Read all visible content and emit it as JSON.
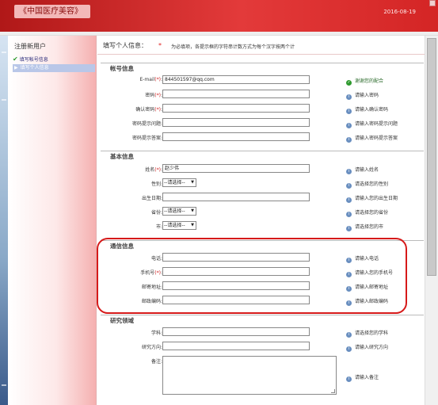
{
  "header": {
    "title": "《中国医疗美容》",
    "date": "2016-08-19"
  },
  "sidebar": {
    "title": "注册新用户",
    "items": [
      {
        "label": "填写帐号信息",
        "state": "done"
      },
      {
        "label": "填写个人信息",
        "state": "active"
      }
    ]
  },
  "main": {
    "title": "填写个人信息：",
    "required_mark": "*",
    "note": "为必填项，各提示框的字符串计数方式为每个汉字按两个计"
  },
  "sections": {
    "account": {
      "title": "帐号信息",
      "fields": [
        {
          "label": "E-mail",
          "required": "(*)",
          "suffix": ":",
          "value": "844501597@qq.com",
          "hint": "谢谢您的配合",
          "hint_type": "ok"
        },
        {
          "label": "密码",
          "required": "(*)",
          "suffix": ":",
          "value": "",
          "hint": "请输入密码",
          "hint_type": "info"
        },
        {
          "label": "确认密码",
          "required": "(*)",
          "suffix": ":",
          "value": "",
          "hint": "请输入确认密码",
          "hint_type": "info"
        },
        {
          "label": "密码提示问题",
          "required": "",
          "suffix": ":",
          "value": "",
          "hint": "请输入密码提示问题",
          "hint_type": "info"
        },
        {
          "label": "密码提示答案",
          "required": "",
          "suffix": ":",
          "value": "",
          "hint": "请输入密码提示答案",
          "hint_type": "info"
        }
      ]
    },
    "basic": {
      "title": "基本信息",
      "fields": [
        {
          "label": "姓名",
          "required": "(*)",
          "suffix": ":",
          "value": "赵少伟",
          "hint": "请输入姓名"
        },
        {
          "label": "性别",
          "required": "",
          "suffix": ":",
          "select": "--请选择--",
          "hint": "请选择您的性别"
        },
        {
          "label": "出生日期",
          "required": "",
          "suffix": ":",
          "value": "",
          "hint": "请输入您的出生日期"
        },
        {
          "label": "省份",
          "required": "",
          "suffix": ":",
          "select": "--请选择--",
          "hint": "请选择您的省份"
        },
        {
          "label": "市",
          "required": "",
          "suffix": ":",
          "select": "--请选择--",
          "hint": "请选择您的市"
        }
      ]
    },
    "contact": {
      "title": "通信信息",
      "fields": [
        {
          "label": "电话",
          "required": "",
          "suffix": ":",
          "value": "",
          "hint": "请输入电话"
        },
        {
          "label": "手机号",
          "required": "(*)",
          "suffix": ":",
          "value": "",
          "hint": "请输入您的手机号"
        },
        {
          "label": "邮寄地址",
          "required": "",
          "suffix": ":",
          "value": "",
          "hint": "请输入邮寄地址"
        },
        {
          "label": "邮政编码",
          "required": "",
          "suffix": ":",
          "value": "",
          "hint": "请输入邮政编码"
        }
      ]
    },
    "research": {
      "title": "研究领域",
      "fields": [
        {
          "label": "学科",
          "required": "",
          "suffix": ":",
          "value": "",
          "hint": "请选择您的学科"
        },
        {
          "label": "研究方向",
          "required": "",
          "suffix": ":",
          "value": "",
          "hint": "请输入研究方向"
        },
        {
          "label": "备注",
          "required": "",
          "suffix": ":",
          "hint": "请输入备注"
        }
      ]
    }
  },
  "colors": {
    "header_red": "#d42525",
    "highlight": "#d61a1a",
    "success": "#2e9a2e",
    "info": "#6a8fc0"
  }
}
